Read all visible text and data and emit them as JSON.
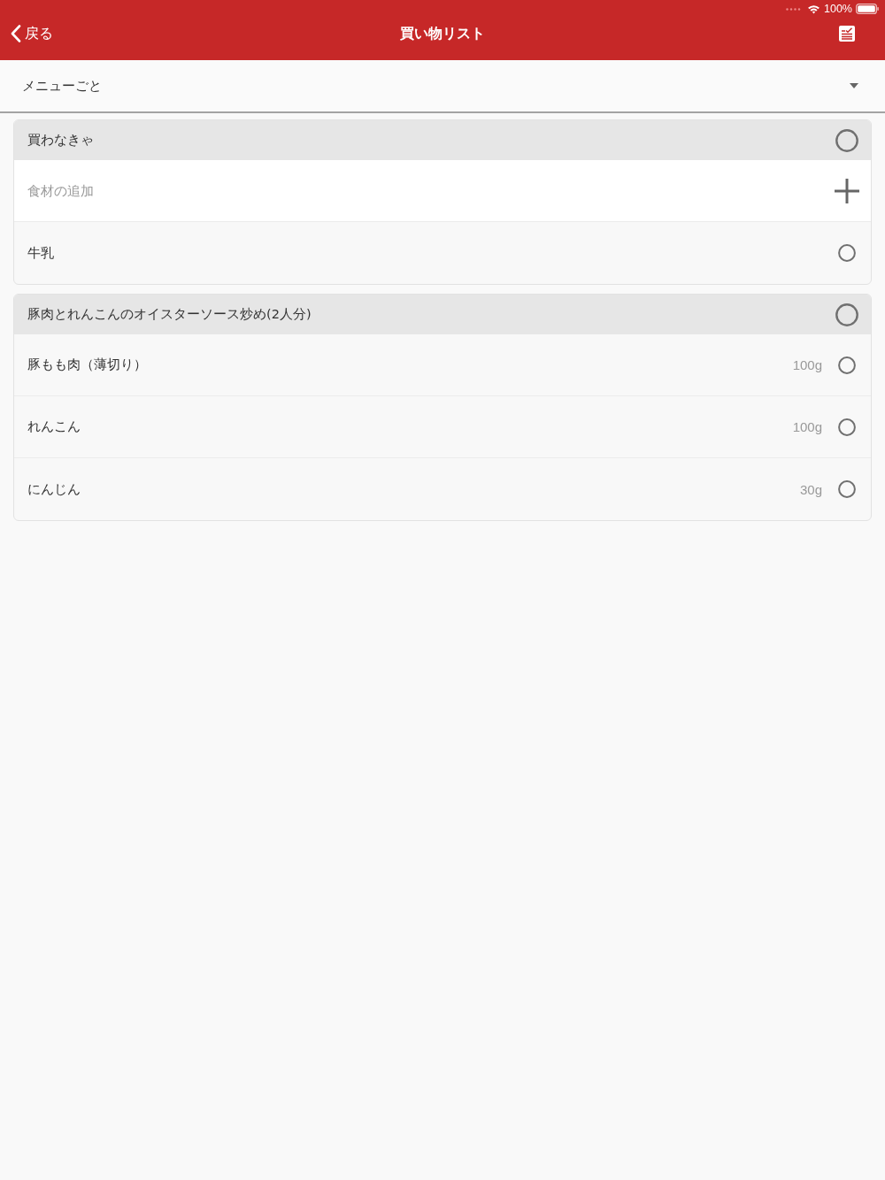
{
  "status_bar": {
    "battery": "100%"
  },
  "nav": {
    "back": "戻る",
    "title": "買い物リスト"
  },
  "group_picker": {
    "value": "メニューごと"
  },
  "sections": [
    {
      "title": "買わなきゃ",
      "checked": false,
      "add_field": {
        "placeholder": "食材の追加"
      },
      "items": [
        {
          "name": "牛乳",
          "checked": false
        }
      ]
    },
    {
      "title": "豚肉とれんこんのオイスターソース炒め(2人分)",
      "checked": false,
      "items": [
        {
          "name": "豚もも肉（薄切り）",
          "amount": "100g",
          "checked": false
        },
        {
          "name": "れんこん",
          "amount": "100g",
          "checked": false
        },
        {
          "name": "にんじん",
          "amount": "30g",
          "checked": false
        }
      ]
    }
  ]
}
